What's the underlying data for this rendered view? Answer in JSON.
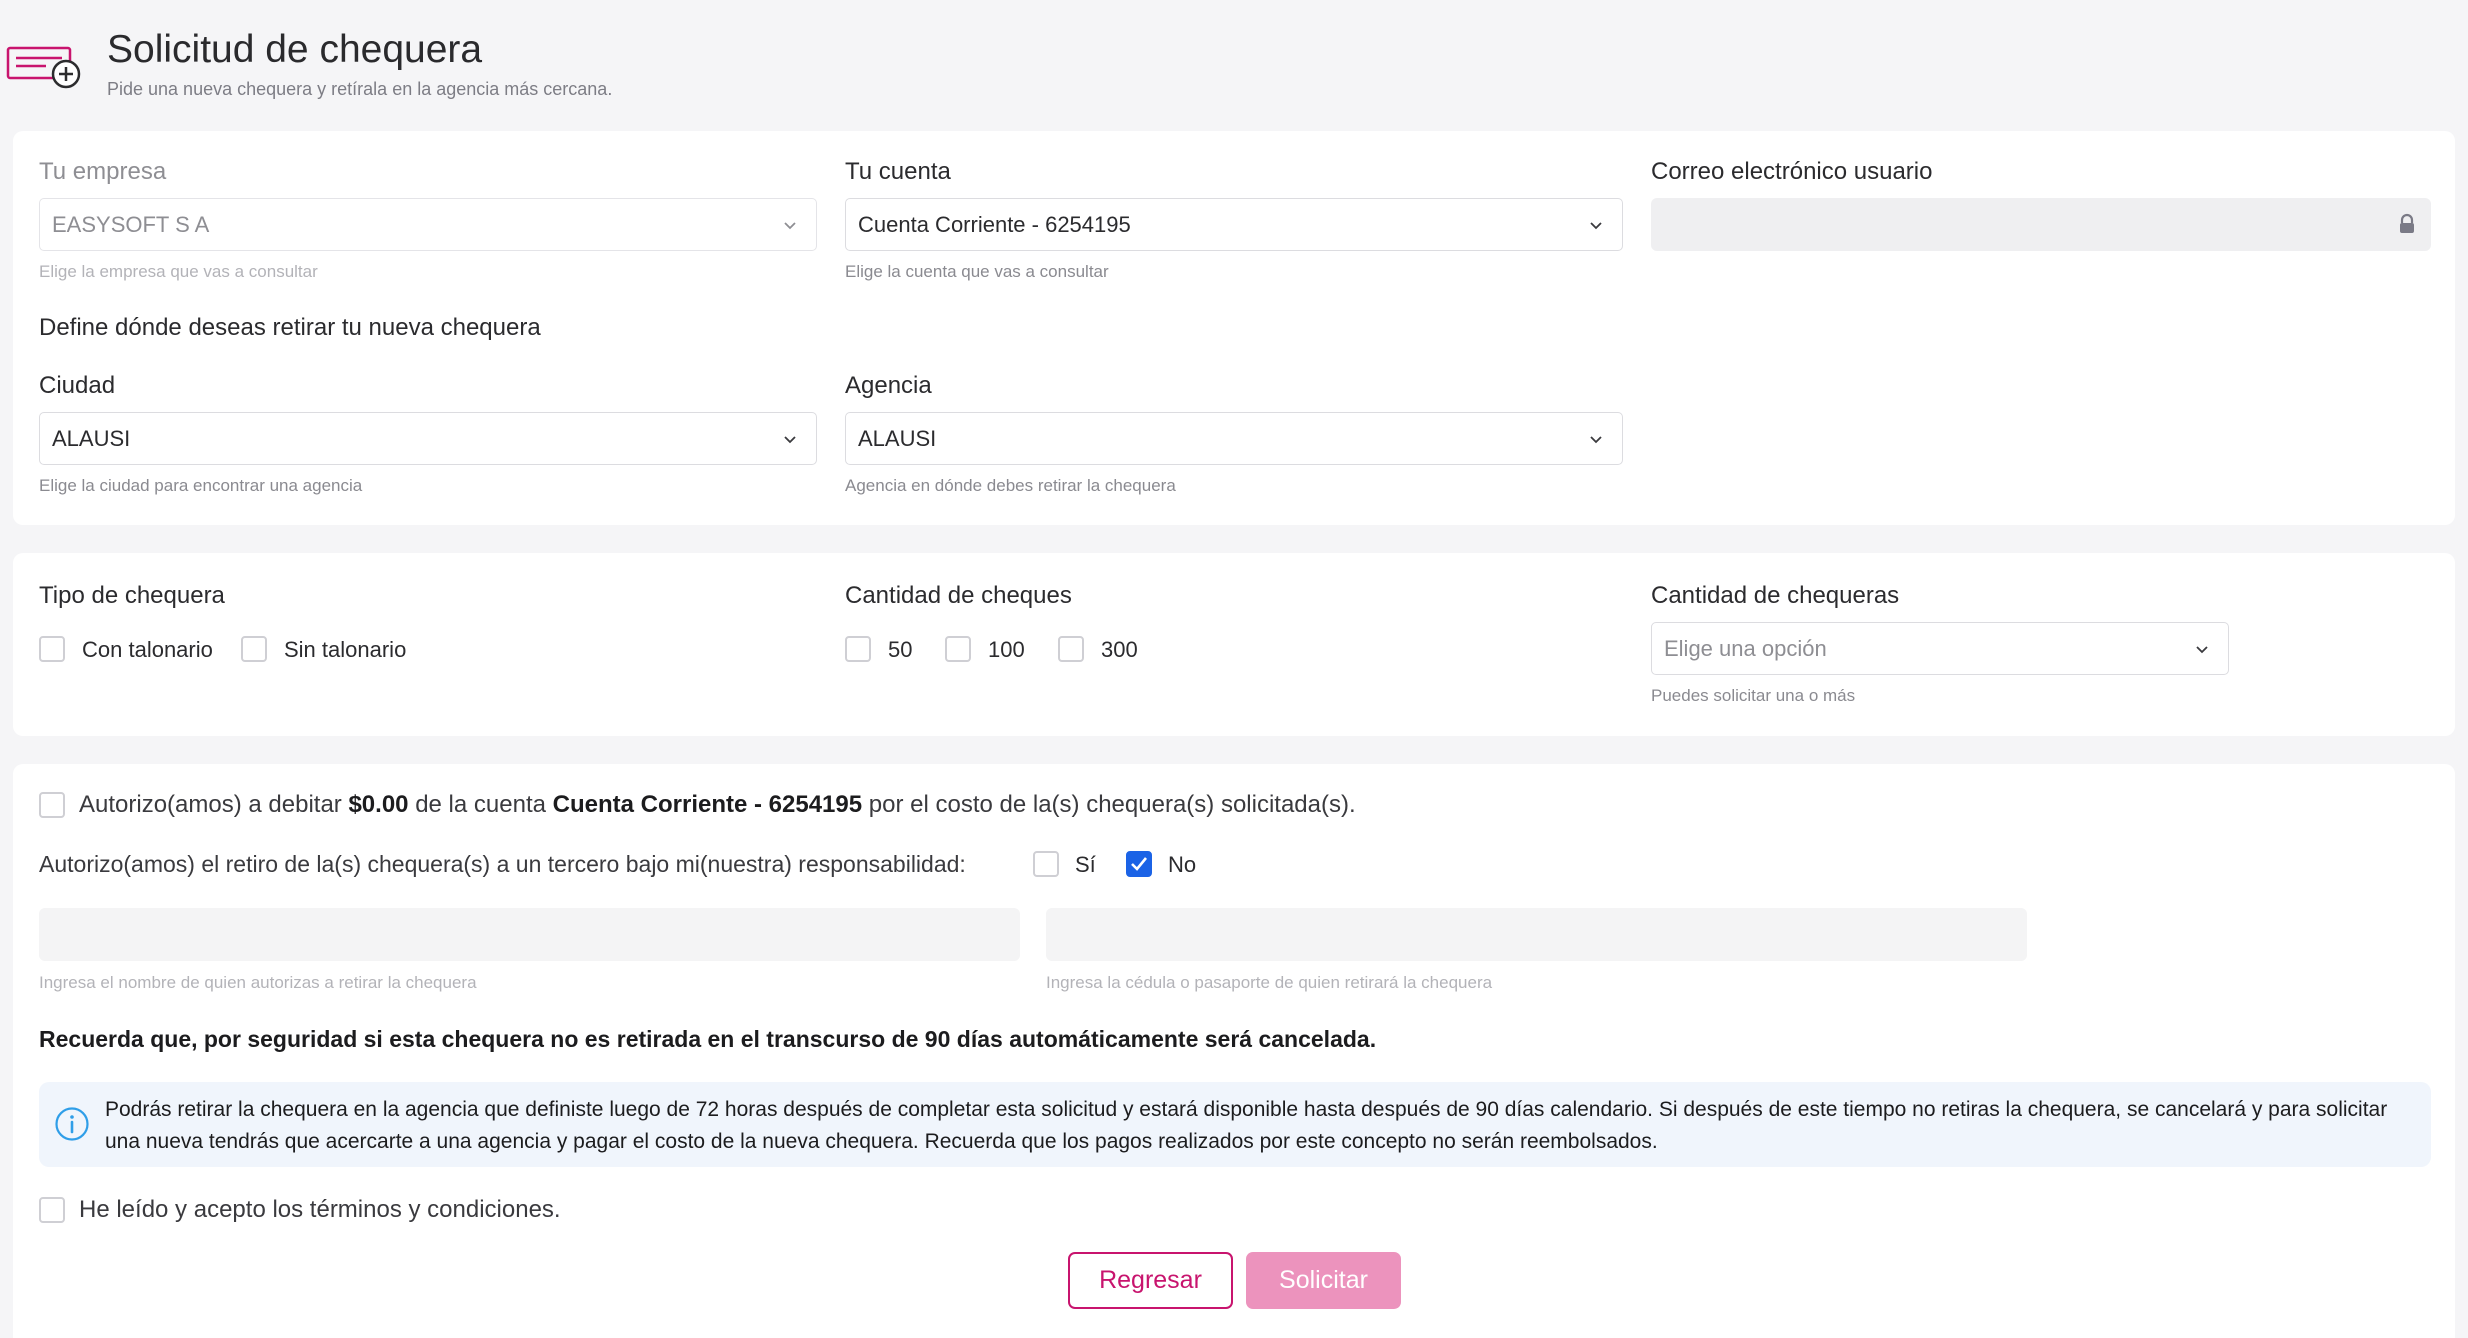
{
  "header": {
    "title": "Solicitud de chequera",
    "subtitle": "Pide una nueva chequera y retírala en la agencia más cercana.",
    "icon": "checkbook-add-icon"
  },
  "colors": {
    "brand": "#c8146e",
    "brand_disabled": "#ec93bd",
    "checkbox_checked": "#1b63e6",
    "info_bg": "#f0f5fc"
  },
  "account_section": {
    "empresa": {
      "label": "Tu empresa",
      "value": "EASYSOFT S A",
      "help": "Elige la empresa que vas a consultar"
    },
    "cuenta": {
      "label": "Tu cuenta",
      "value": "Cuenta Corriente - 6254195",
      "help": "Elige la cuenta que vas a consultar"
    },
    "correo": {
      "label": "Correo electrónico usuario",
      "value": ""
    },
    "pickup_heading": "Define dónde deseas retirar tu nueva chequera",
    "ciudad": {
      "label": "Ciudad",
      "value": "ALAUSI",
      "help": "Elige la ciudad para encontrar una agencia"
    },
    "agencia": {
      "label": "Agencia",
      "value": "ALAUSI",
      "help": "Agencia en dónde debes retirar la chequera"
    }
  },
  "checkbook_section": {
    "tipo": {
      "label": "Tipo de chequera",
      "options": [
        {
          "label": "Con talonario",
          "checked": false
        },
        {
          "label": "Sin talonario",
          "checked": false
        }
      ]
    },
    "cantidad_cheques": {
      "label": "Cantidad de cheques",
      "options": [
        {
          "label": "50",
          "checked": false
        },
        {
          "label": "100",
          "checked": false
        },
        {
          "label": "300",
          "checked": false
        }
      ]
    },
    "cantidad_chequeras": {
      "label": "Cantidad de chequeras",
      "placeholder": "Elige una opción",
      "help": "Puedes solicitar una o más"
    }
  },
  "authorization": {
    "debit": {
      "prefix": "Autorizo(amos) a debitar",
      "amount": "$0.00",
      "middle": "de la cuenta",
      "account": "Cuenta Corriente - 6254195",
      "suffix": "por el costo de la(s) chequera(s) solicitada(s).",
      "checked": false
    },
    "third_party": {
      "text": "Autorizo(amos) el retiro de la(s) chequera(s) a un tercero bajo mi(nuestra) responsabilidad:",
      "yes_label": "Sí",
      "no_label": "No",
      "selected": "No"
    },
    "name_input": {
      "value": "",
      "help": "Ingresa el nombre de quien autorizas a retirar la chequera"
    },
    "id_input": {
      "value": "",
      "help": "Ingresa la cédula o pasaporte de quien retirará la chequera"
    },
    "reminder": "Recuerda que, por seguridad si esta chequera no es retirada en el transcurso de 90 días automáticamente será cancelada.",
    "info_line1": "Podrás retirar la chequera en la agencia que definiste luego de 72 horas después de completar esta solicitud y estará disponible hasta después de 90 días calendario. Si después de este tiempo no retiras la chequera, se cancelará y para solicitar",
    "info_line2": "una nueva tendrás que acercarte a una agencia y pagar el costo de la nueva chequera. Recuerda que los pagos realizados por este concepto no serán reembolsados.",
    "terms": {
      "label": "He leído y acepto los términos y condiciones.",
      "checked": false
    }
  },
  "actions": {
    "back_label": "Regresar",
    "submit_label": "Solicitar"
  }
}
